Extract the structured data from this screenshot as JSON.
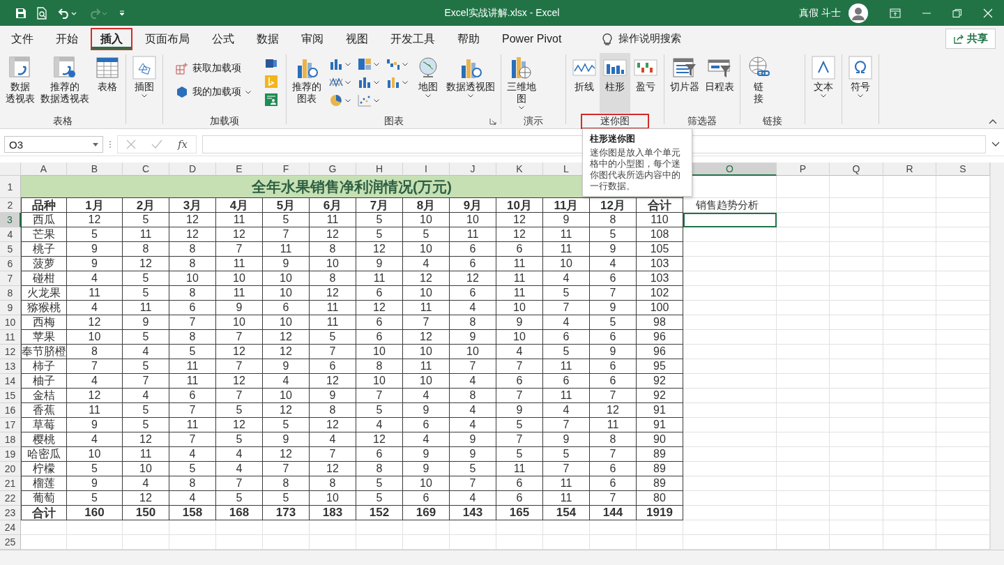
{
  "window": {
    "title": "Excel实战讲解.xlsx  -  Excel",
    "user": "真假 斗士"
  },
  "menu_tabs": [
    {
      "label": "文件",
      "selected": false,
      "annotated": false
    },
    {
      "label": "开始",
      "selected": false,
      "annotated": false
    },
    {
      "label": "插入",
      "selected": true,
      "annotated": true
    },
    {
      "label": "页面布局",
      "selected": false,
      "annotated": false
    },
    {
      "label": "公式",
      "selected": false,
      "annotated": false
    },
    {
      "label": "数据",
      "selected": false,
      "annotated": false
    },
    {
      "label": "审阅",
      "selected": false,
      "annotated": false
    },
    {
      "label": "视图",
      "selected": false,
      "annotated": false
    },
    {
      "label": "开发工具",
      "selected": false,
      "annotated": false
    },
    {
      "label": "帮助",
      "selected": false,
      "annotated": false
    },
    {
      "label": "Power Pivot",
      "selected": false,
      "annotated": false
    }
  ],
  "tell_me": "操作说明搜索",
  "share_button": "共享",
  "ribbon_groups": [
    {
      "kind": "large",
      "label": "表格",
      "annotated": false,
      "buttons": [
        {
          "lines": [
            "数据",
            "透视表"
          ],
          "highlighted": false,
          "dropdown": false
        },
        {
          "lines": [
            "推荐的",
            "数据透视表"
          ],
          "highlighted": false,
          "dropdown": false
        },
        {
          "lines": [
            "表格"
          ],
          "highlighted": false,
          "dropdown": false
        }
      ]
    },
    {
      "kind": "large",
      "buttons": [
        {
          "lines": [
            "插图"
          ],
          "highlighted": false,
          "dropdown": true
        }
      ]
    },
    {
      "kind": "addins",
      "label": "加载项",
      "annotated": false,
      "buttons": [
        {
          "label": "获取加载项",
          "highlighted": false,
          "dropdown": false
        },
        {
          "label": "我的加载项",
          "highlighted": false,
          "dropdown": true
        }
      ]
    },
    {
      "kind": "charts",
      "label": "图表",
      "annotated": false,
      "buttons": [
        {
          "lines": [
            "推荐的",
            "图表"
          ],
          "highlighted": false,
          "dropdown": false
        },
        {
          "lines": [
            "地图"
          ],
          "highlighted": false,
          "dropdown": true
        },
        {
          "lines": [
            "数据透视图"
          ],
          "highlighted": false,
          "dropdown": true
        }
      ]
    },
    {
      "kind": "large",
      "label": "演示",
      "annotated": false,
      "buttons": [
        {
          "lines": [
            "三维地",
            "图"
          ],
          "highlighted": false,
          "dropdown": true
        }
      ]
    },
    {
      "kind": "large",
      "label": "迷你图",
      "annotated": true,
      "buttons": [
        {
          "lines": [
            "折线"
          ],
          "highlighted": false,
          "dropdown": false
        },
        {
          "lines": [
            "柱形"
          ],
          "highlighted": true,
          "dropdown": false
        },
        {
          "lines": [
            "盈亏"
          ],
          "highlighted": false,
          "dropdown": false
        }
      ]
    },
    {
      "kind": "large",
      "label": "筛选器",
      "annotated": false,
      "buttons": [
        {
          "lines": [
            "切片器"
          ],
          "highlighted": false,
          "dropdown": false
        },
        {
          "lines": [
            "日程表"
          ],
          "highlighted": false,
          "dropdown": false
        }
      ]
    },
    {
      "kind": "large",
      "label": "链接",
      "annotated": false,
      "buttons": [
        {
          "lines": [
            "链",
            "接"
          ],
          "highlighted": false,
          "dropdown": false
        }
      ]
    },
    {
      "kind": "large",
      "buttons": [
        {
          "lines": [
            "文本"
          ],
          "highlighted": false,
          "dropdown": true
        }
      ]
    },
    {
      "kind": "large",
      "buttons": [
        {
          "lines": [
            "符号"
          ],
          "highlighted": false,
          "dropdown": true
        }
      ]
    }
  ],
  "formula_bar": {
    "name_box": "O3",
    "function_label": "fx"
  },
  "tooltip": {
    "title": "柱形迷你图",
    "body": "迷你图是放入单个单元格中的小型图，每个迷你图代表所选内容中的一行数据。"
  },
  "sheet": {
    "columns": [
      {
        "label": "A",
        "selected": false
      },
      {
        "label": "B",
        "selected": false
      },
      {
        "label": "C",
        "selected": false
      },
      {
        "label": "D",
        "selected": false
      },
      {
        "label": "E",
        "selected": false
      },
      {
        "label": "F",
        "selected": false
      },
      {
        "label": "G",
        "selected": false
      },
      {
        "label": "H",
        "selected": false
      },
      {
        "label": "I",
        "selected": false
      },
      {
        "label": "J",
        "selected": false
      },
      {
        "label": "K",
        "selected": false
      },
      {
        "label": "L",
        "selected": false
      },
      {
        "label": "O",
        "selected": true
      },
      {
        "label": "P",
        "selected": false
      },
      {
        "label": "Q",
        "selected": false
      },
      {
        "label": "R",
        "selected": false
      },
      {
        "label": "S",
        "selected": false
      }
    ],
    "row_numbers": [
      {
        "label": "1",
        "selected": false
      },
      {
        "label": "2",
        "selected": false
      },
      {
        "label": "3",
        "selected": true
      },
      {
        "label": "4",
        "selected": false
      },
      {
        "label": "5",
        "selected": false
      },
      {
        "label": "6",
        "selected": false
      },
      {
        "label": "7",
        "selected": false
      },
      {
        "label": "8",
        "selected": false
      },
      {
        "label": "9",
        "selected": false
      },
      {
        "label": "10",
        "selected": false
      },
      {
        "label": "11",
        "selected": false
      },
      {
        "label": "12",
        "selected": false
      },
      {
        "label": "13",
        "selected": false
      },
      {
        "label": "14",
        "selected": false
      },
      {
        "label": "15",
        "selected": false
      },
      {
        "label": "16",
        "selected": false
      },
      {
        "label": "17",
        "selected": false
      },
      {
        "label": "18",
        "selected": false
      },
      {
        "label": "19",
        "selected": false
      },
      {
        "label": "20",
        "selected": false
      },
      {
        "label": "21",
        "selected": false
      },
      {
        "label": "22",
        "selected": false
      },
      {
        "label": "23",
        "selected": false
      },
      {
        "label": "24",
        "selected": false
      },
      {
        "label": "25",
        "selected": false
      }
    ],
    "title": "全年水果销售净利润情况(万元)",
    "header": [
      "品种",
      "1月",
      "2月",
      "3月",
      "4月",
      "5月",
      "6月",
      "7月",
      "8月",
      "9月",
      "10月",
      "11月",
      "12月",
      "合计"
    ],
    "note": "销售趋势分析",
    "rows": [
      [
        "西瓜",
        "12",
        "5",
        "12",
        "11",
        "5",
        "11",
        "5",
        "10",
        "10",
        "12",
        "9",
        "8",
        "110"
      ],
      [
        "芒果",
        "5",
        "11",
        "12",
        "12",
        "7",
        "12",
        "5",
        "5",
        "11",
        "12",
        "11",
        "5",
        "108"
      ],
      [
        "桃子",
        "9",
        "8",
        "8",
        "7",
        "11",
        "8",
        "12",
        "10",
        "6",
        "6",
        "11",
        "9",
        "105"
      ],
      [
        "菠萝",
        "9",
        "12",
        "8",
        "11",
        "9",
        "10",
        "9",
        "4",
        "6",
        "11",
        "10",
        "4",
        "103"
      ],
      [
        "碰柑",
        "4",
        "5",
        "10",
        "10",
        "10",
        "8",
        "11",
        "12",
        "12",
        "11",
        "4",
        "6",
        "103"
      ],
      [
        "火龙果",
        "11",
        "5",
        "8",
        "11",
        "10",
        "12",
        "6",
        "10",
        "6",
        "11",
        "5",
        "7",
        "102"
      ],
      [
        "猕猴桃",
        "4",
        "11",
        "6",
        "9",
        "6",
        "11",
        "12",
        "11",
        "4",
        "10",
        "7",
        "9",
        "100"
      ],
      [
        "西梅",
        "12",
        "9",
        "7",
        "10",
        "10",
        "11",
        "6",
        "7",
        "8",
        "9",
        "4",
        "5",
        "98"
      ],
      [
        "苹果",
        "10",
        "5",
        "8",
        "7",
        "12",
        "5",
        "6",
        "12",
        "9",
        "10",
        "6",
        "6",
        "96"
      ],
      [
        "奉节脐橙",
        "8",
        "4",
        "5",
        "12",
        "12",
        "7",
        "10",
        "10",
        "10",
        "4",
        "5",
        "9",
        "96"
      ],
      [
        "柿子",
        "7",
        "5",
        "11",
        "7",
        "9",
        "6",
        "8",
        "11",
        "7",
        "7",
        "11",
        "6",
        "95"
      ],
      [
        "柚子",
        "4",
        "7",
        "11",
        "12",
        "4",
        "12",
        "10",
        "10",
        "4",
        "6",
        "6",
        "6",
        "92"
      ],
      [
        "金桔",
        "12",
        "4",
        "6",
        "7",
        "10",
        "9",
        "7",
        "4",
        "8",
        "7",
        "11",
        "7",
        "92"
      ],
      [
        "香蕉",
        "11",
        "5",
        "7",
        "5",
        "12",
        "8",
        "5",
        "9",
        "4",
        "9",
        "4",
        "12",
        "91"
      ],
      [
        "草莓",
        "9",
        "5",
        "11",
        "12",
        "5",
        "12",
        "4",
        "6",
        "4",
        "5",
        "7",
        "11",
        "91"
      ],
      [
        "樱桃",
        "4",
        "12",
        "7",
        "5",
        "9",
        "4",
        "12",
        "4",
        "9",
        "7",
        "9",
        "8",
        "90"
      ],
      [
        "哈密瓜",
        "10",
        "11",
        "4",
        "4",
        "12",
        "7",
        "6",
        "9",
        "9",
        "5",
        "5",
        "7",
        "89"
      ],
      [
        "柠檬",
        "5",
        "10",
        "5",
        "4",
        "7",
        "12",
        "8",
        "9",
        "5",
        "11",
        "7",
        "6",
        "89"
      ],
      [
        "榴莲",
        "9",
        "4",
        "8",
        "7",
        "8",
        "8",
        "5",
        "10",
        "7",
        "6",
        "11",
        "6",
        "89"
      ],
      [
        "葡萄",
        "5",
        "12",
        "4",
        "5",
        "5",
        "10",
        "5",
        "6",
        "4",
        "6",
        "11",
        "7",
        "80"
      ]
    ],
    "total": [
      "合计",
      "160",
      "150",
      "158",
      "168",
      "173",
      "183",
      "152",
      "169",
      "143",
      "165",
      "154",
      "144",
      "1919"
    ]
  }
}
